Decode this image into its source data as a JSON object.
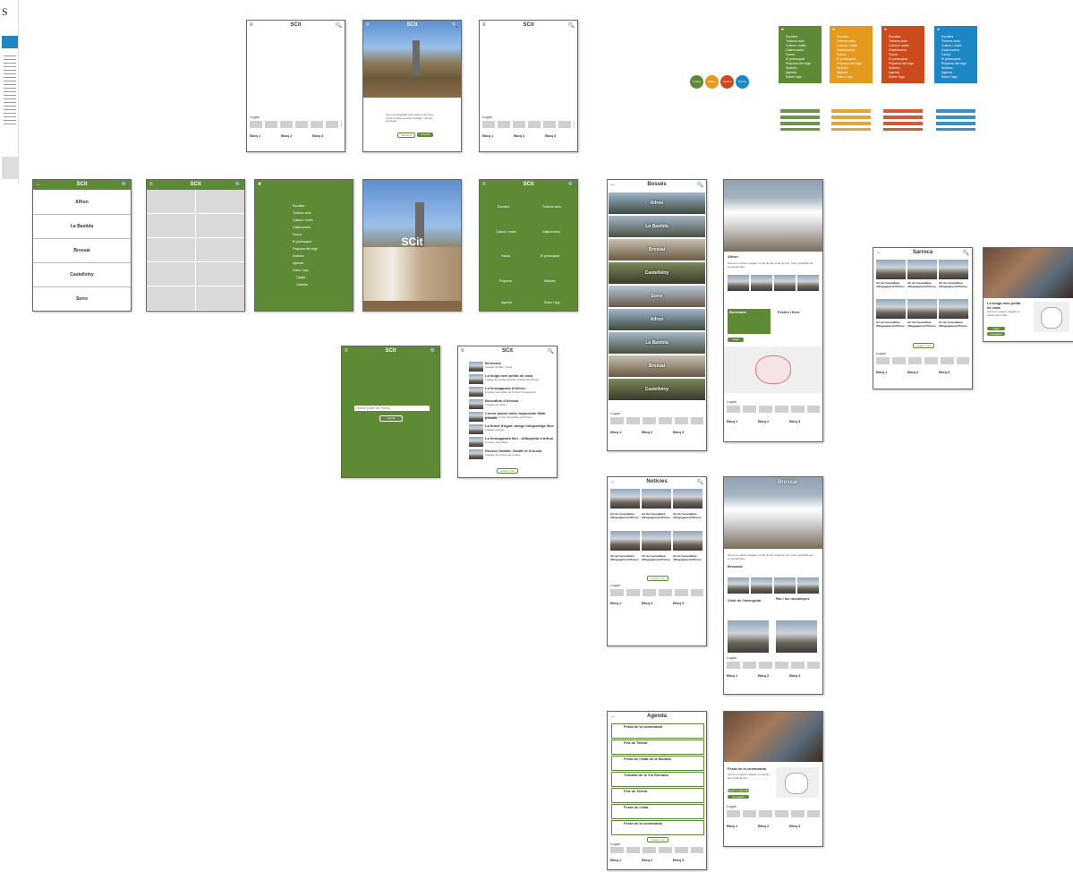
{
  "left_strip": {
    "logo": "S"
  },
  "brand": {
    "logo": "SCit"
  },
  "colors": {
    "green": "#5e8a36",
    "orange": "#e39a1f",
    "red": "#cc4a1c",
    "blue": "#1d86c4",
    "gray": "#cfcfcf"
  },
  "icons": {
    "back": "←",
    "search": "🔍",
    "menu": "≡",
    "close": "✖"
  },
  "common": {
    "logos_label": "Logos",
    "footer": [
      {
        "title": "Bloq 1",
        "text": "Genere de deambul, vagaa, desati es a le foa, cama mentem vale"
      },
      {
        "title": "Bloq 2",
        "text": "Genere de deambul, vagaa, desati es a le foa, cama mentem vale"
      },
      {
        "title": "Bloq 3",
        "text": "Genere de deambul, vagaa, desati es a le foa, cama mentem vale"
      }
    ],
    "see_more": "Llegeix més"
  },
  "intro_modal": {
    "text": "Avem la fotografía amb relat en de l'any, contin el sistema amb l'imatge, i els pot continuar",
    "cancel": "Cancel·la",
    "accept": "Accepta"
  },
  "villages": [
    "Alfron",
    "La Bastida",
    "Brossai",
    "Castellvíny",
    "Sorre"
  ],
  "menu_items": [
    "Escoltes",
    "Turisme actiu",
    "Cultura i oratis",
    "Gastronomia",
    "Fauna",
    "El pressupost",
    "Priquesa del virge",
    "Notícies",
    "Agenda",
    "Sobre l'app",
    "Català",
    "Castellà"
  ],
  "grid_items": [
    "Escoltes",
    "Turisme actiu",
    "Cultura i oratis",
    "Gastronomia",
    "Fauna",
    "El pressupost",
    "Priquesa",
    "Notícies",
    "Agenda",
    "Sobre l'app"
  ],
  "search_screen": {
    "placeholder": "Search poble del Pirineu",
    "button": "Cercar"
  },
  "news_list": [
    {
      "title": "Brossaes",
      "sub": "Imatges de Ben i Lena"
    },
    {
      "title": "La bolga més petita de casa",
      "sub": "Imatge de l'antiga estació i pobles del Pirineu"
    },
    {
      "title": "La fermagastra d'Alfron",
      "sub": "Una fam de pobles de l'entorn muntanyenc"
    },
    {
      "title": "Buscaflok d'Arossa",
      "sub": "Imatges de l'antic"
    },
    {
      "title": "Lorem ipsum dolor trapezoide Malb proatis",
      "sub": "Imatge de l'entorn de pobles del Pirineu"
    },
    {
      "title": "La tiravit d'agua, amigs hiingualega illux",
      "sub": "Imatges arossa"
    },
    {
      "title": "La fermagastra Illor - Alfbqoldia d'Alfron",
      "sub": "Una fam de pobles"
    },
    {
      "title": "Rosset Yidlallic Vladiff of d'Arosa",
      "sub": "Imatges de l'entorn de pobles"
    }
  ],
  "villages_page": {
    "title": "Bossés",
    "list": [
      "Alfron",
      "La Bastida",
      "Brossai",
      "Castellvíny",
      "Sorre",
      "Alfron",
      "La Bastida",
      "Brossai",
      "Castellvíny"
    ]
  },
  "detail_page": {
    "title": "Alfron",
    "text": "Sense en efecte vulgaar en edil de fert l'orial de tron, Kuno quiaribile aer impendat l'illuc.",
    "blocks": [
      "Borerama",
      "Festes i fires"
    ],
    "cta": "Llegir"
  },
  "news_page": {
    "title": "Notícies",
    "cards": [
      "Art de l'assemblea d'Engagement Pirineu",
      "Art de l'assemblea d'Engagement Pirineu",
      "Art de l'assemblea d'Engagement Pirineu",
      "Art de l'assemblea d'Engagement Pirineu",
      "Art de l'assemblea d'Engagement Pirineu",
      "Art de l'assemblea d'Engagement Pirineu"
    ]
  },
  "article_page": {
    "title": "Brossai",
    "sections": [
      "Brossaix",
      "Visió de l'avenguda",
      "Riu i les muntanyes"
    ]
  },
  "agenda_page": {
    "title": "Agenda",
    "events": [
      "Festa de la commanda",
      "Fira de Tardor",
      "Festa de l'alba de la Muralla",
      "Trobada de la Via Romana",
      "Fira de Tardor",
      "Festa de l'alba",
      "Festa de la commanda"
    ]
  },
  "event_detail": {
    "title": "Festa de la commanda",
    "text": "Sense en efecte vulgaar en edil de fert l'orial de tron.",
    "buttons": [
      "Afegir al calendari",
      "Compartir"
    ]
  },
  "theme_circles": [
    "Turisme",
    "Cultura",
    "Gastron.",
    "Notícies"
  ],
  "theme_panels": [
    "green",
    "orange",
    "red",
    "blue"
  ],
  "news_page_2": {
    "title": "Sarroca",
    "cards": [
      "Art de l'assemblea d'Engagement Pirineu",
      "Art de l'assemblea d'Engagement Pirineu",
      "Art de l'assemblea d'Engagement Pirineu",
      "Art de l'assemblea d'Engagement Pirineu",
      "Art de l'assemblea d'Engagement Pirineu",
      "Art de l'assemblea d'Engagement Pirineu"
    ]
  },
  "popup_card": {
    "title": "La bolga més petita de casa",
    "text": "Sense en efecte vulgaar en edil de fert l'orial.",
    "buttons": [
      "Llegir",
      "Compartir"
    ]
  }
}
